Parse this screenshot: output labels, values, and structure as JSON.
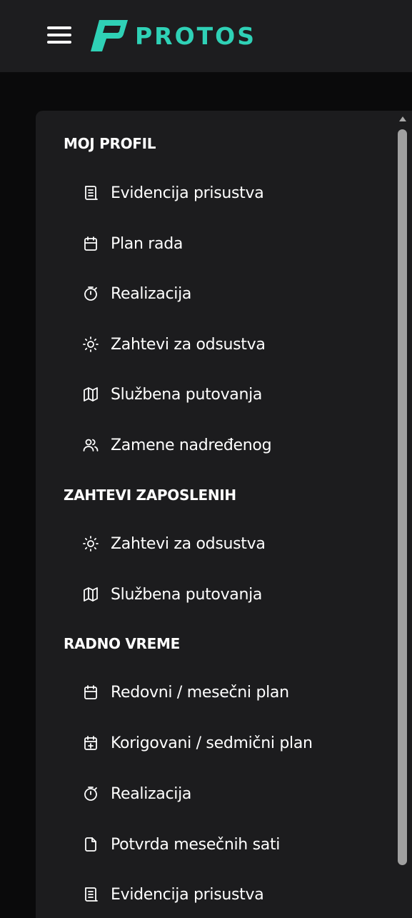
{
  "header": {
    "menu_icon": "hamburger-menu-icon",
    "logo_text": "PROTOS",
    "logo_color": "#2fd1b6"
  },
  "sidebar": {
    "sections": [
      {
        "title": "MOJ PROFIL",
        "items": [
          {
            "label": "Evidencija prisustva",
            "icon": "list-document-icon"
          },
          {
            "label": "Plan rada",
            "icon": "calendar-icon"
          },
          {
            "label": "Realizacija",
            "icon": "stopwatch-icon"
          },
          {
            "label": "Zahtevi za odsustva",
            "icon": "sun-icon"
          },
          {
            "label": "Službena putovanja",
            "icon": "map-icon"
          },
          {
            "label": "Zamene nadređenog",
            "icon": "users-icon"
          }
        ]
      },
      {
        "title": "ZAHTEVI ZAPOSLENIH",
        "items": [
          {
            "label": "Zahtevi za odsustva",
            "icon": "sun-icon"
          },
          {
            "label": "Službena putovanja",
            "icon": "map-icon"
          }
        ]
      },
      {
        "title": "RADNO VREME",
        "items": [
          {
            "label": "Redovni / mesečni plan",
            "icon": "calendar-icon"
          },
          {
            "label": "Korigovani / sedmični plan",
            "icon": "calendar-plus-icon"
          },
          {
            "label": "Realizacija",
            "icon": "stopwatch-icon"
          },
          {
            "label": "Potvrda mesečnih sati",
            "icon": "file-icon"
          },
          {
            "label": "Evidencija prisustva",
            "icon": "list-document-icon"
          }
        ]
      }
    ]
  }
}
